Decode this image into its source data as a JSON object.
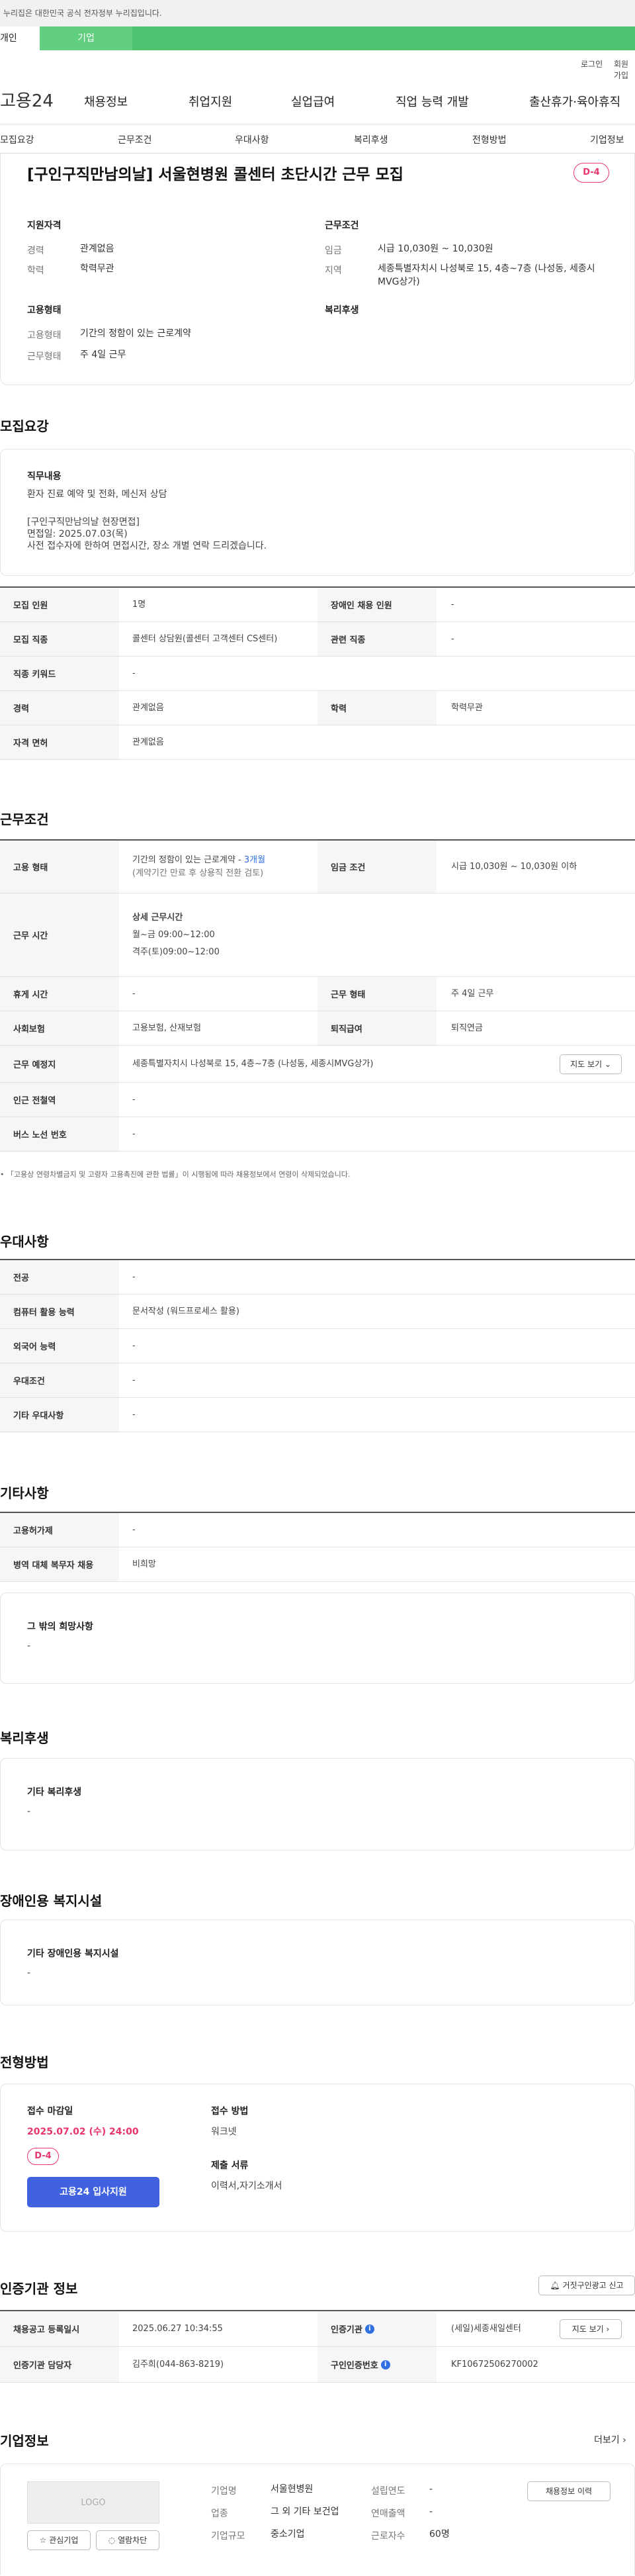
{
  "notice": "이 누리집은 대한민국 공식 전자정부 누리집입니다.",
  "user_tabs": [
    "개인",
    "기업"
  ],
  "util": {
    "login": "로그인",
    "join": "회원가입"
  },
  "logo": "고용24",
  "gnb": [
    "채용정보",
    "취업지원",
    "실업급여",
    "직업 능력 개발",
    "출산휴가·육아휴직"
  ],
  "tabs": [
    "모집요강",
    "근무조건",
    "우대사항",
    "복리후생",
    "전형방법",
    "기업정보"
  ],
  "job": {
    "title": "[구인구직만남의날] 서울현병원 콜센터 초단시간 근무 모집",
    "dday": "D-4",
    "qual_head": "지원자격",
    "career_label": "경력",
    "career": "관계없음",
    "edu_label": "학력",
    "edu": "학력무관",
    "cond_head": "근무조건",
    "wage_label": "임금",
    "wage": "시급 10,030원 ~ 10,030원",
    "area_label": "지역",
    "area": "세종특별자치시 나성북로 15, 4층~7층 (나성동, 세종시 MVG상가)",
    "type_head": "고용형태",
    "emp_label": "고용형태",
    "emp": "기간의 정함이 있는 근로계약",
    "work_label": "근무형태",
    "work": "주 4일 근무",
    "welfare_head": "복리후생"
  },
  "recruit": {
    "title": "모집요강",
    "duty_head": "직무내용",
    "duty_lines": [
      "환자 진료 예약 및 전화, 메신저 상담",
      "",
      "[구인구직만남의날 현장면접]",
      "면접일: 2025.07.03(목)",
      "사전 접수자에 한하여 면접시간, 장소 개별 연락 드리겠습니다."
    ],
    "rows": [
      {
        "l1": "모집 인원",
        "v1": "1명",
        "l2": "장애인 채용 인원",
        "v2": "-"
      },
      {
        "l1": "모집 직종",
        "v1": "콜센터 상담원(콜센터 고객센터 CS센터)",
        "l2": "관련 직종",
        "v2": "-"
      },
      {
        "l1": "직종 키워드",
        "v1": "-"
      },
      {
        "l1": "경력",
        "v1": "관계없음",
        "l2": "학력",
        "v2": "학력무관"
      },
      {
        "l1": "자격 면허",
        "v1": "관계없음"
      }
    ]
  },
  "cond": {
    "title": "근무조건",
    "emp_label": "고용 형태",
    "emp1": "기간의 정함이 있는 근로계약 - ",
    "emp_months": "3개월",
    "emp2": "(계약기간 만료 후 상용직 전환 검토)",
    "wage_label": "임금 조건",
    "wage": "시급 10,030원 ~ 10,030원 이하",
    "hours_label": "근무 시간",
    "hours_head": "상세 근무시간",
    "hours1": "월~금 09:00~12:00",
    "hours2": "격주(토)09:00~12:00",
    "rest_label": "휴게 시간",
    "rest": "-",
    "worktype_label": "근무 형태",
    "worktype": "주 4일 근무",
    "ins_label": "사회보험",
    "ins": "고용보험, 산재보험",
    "sev_label": "퇴직급여",
    "sev": "퇴직연금",
    "place_label": "근무 예정지",
    "place": "세종특별자치시 나성북로 15, 4층~7층 (나성동, 세종시MVG상가)",
    "map_btn": "지도 보기",
    "subway_label": "인근 전철역",
    "subway": "-",
    "bus_label": "버스 노선 번호",
    "bus": "-",
    "note": "「고용상 연령차별금지 및 고령자 고용촉진에 관한 법률」이 시행됨에 따라 채용정보에서 연령이 삭제되었습니다."
  },
  "pref": {
    "title": "우대사항",
    "rows": [
      {
        "l": "전공",
        "v": "-"
      },
      {
        "l": "컴퓨터 활용 능력",
        "v": "문서작성 (워드프로세스 활용)"
      },
      {
        "l": "외국어 능력",
        "v": "-"
      },
      {
        "l": "우대조건",
        "v": "-"
      },
      {
        "l": "기타 우대사항",
        "v": "-"
      }
    ]
  },
  "etc": {
    "title": "기타사항",
    "rows": [
      {
        "l": "고용허가제",
        "v": "-"
      },
      {
        "l": "병역 대체 복무자 채용",
        "v": "비희망"
      }
    ],
    "box_head": "그 밖의 희망사항",
    "box_val": "-"
  },
  "welfare": {
    "title": "복리후생",
    "head": "기타 복리후생",
    "val": "-"
  },
  "disabled": {
    "title": "장애인용 복지시설",
    "head": "기타 장애인용 복지시설",
    "val": "-"
  },
  "process": {
    "title": "전형방법",
    "deadline_head": "접수 마감일",
    "deadline": "2025.07.02 (수) 24:00",
    "dday": "D-4",
    "apply_btn": "고용24 입사지원",
    "method_head": "접수 방법",
    "method": "워크넷",
    "docs_head": "제출 서류",
    "docs": "이력서,자기소개서"
  },
  "cert": {
    "title": "인증기관 정보",
    "report_btn": "거짓구인광고 신고",
    "reg_label": "채용공고 등록일시",
    "reg": "2025.06.27 10:34:55",
    "org_label": "인증기관",
    "org": "(세일)세종새일센터",
    "map_btn": "지도 보기",
    "mgr_label": "인증기관 담당자",
    "mgr": "김주희(044-863-8219)",
    "num_label": "구인인증번호",
    "num": "KF10672506270002"
  },
  "company": {
    "title": "기업정보",
    "more": "더보기",
    "logo": "LOGO",
    "fav_btn": "관심기업",
    "block_btn": "열람차단",
    "name_label": "기업명",
    "name": "서울현병원",
    "industry_label": "업종",
    "industry": "그 외 기타 보건업",
    "size_label": "기업규모",
    "size": "중소기업",
    "est_label": "설립연도",
    "est": "-",
    "sales_label": "연매출액",
    "sales": "-",
    "emp_label": "근로자수",
    "emp": "60명",
    "history_btn": "채용정보 이력"
  }
}
